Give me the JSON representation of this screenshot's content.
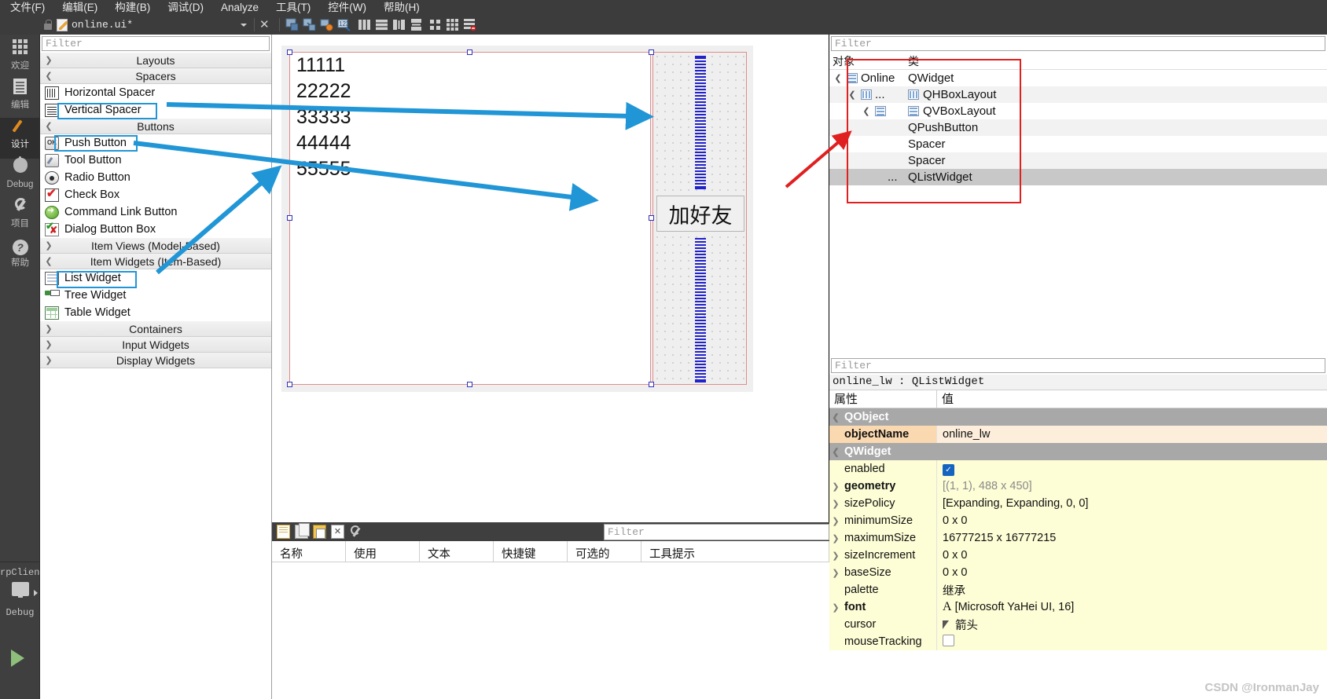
{
  "menubar": {
    "items": [
      "文件(F)",
      "编辑(E)",
      "构建(B)",
      "调试(D)",
      "Analyze",
      "工具(T)",
      "控件(W)",
      "帮助(H)"
    ]
  },
  "toolbar": {
    "filename": "online.ui*",
    "lock_icon": "lock-icon",
    "doc_icon": "ui-file-icon",
    "close_label": "✕",
    "icons": [
      "adjust-size-icon",
      "lay-out-break-icon",
      "signals-slots-icon",
      "buddy-edit-icon",
      "lay-out-horizontally-icon",
      "lay-out-vertically-icon",
      "lay-out-splitter-h-icon",
      "lay-out-splitter-v-icon",
      "lay-out-form-icon",
      "lay-out-grid-icon",
      "break-layout-icon"
    ]
  },
  "modebar": {
    "items": [
      {
        "label": "欢迎",
        "icon": "grid-icon",
        "active": false
      },
      {
        "label": "编辑",
        "icon": "document-icon",
        "active": false
      },
      {
        "label": "设计",
        "icon": "pencil-icon",
        "active": true
      },
      {
        "label": "Debug",
        "icon": "bug-icon",
        "active": false
      },
      {
        "label": "项目",
        "icon": "wrench-icon",
        "active": false
      },
      {
        "label": "帮助",
        "icon": "help-icon",
        "active": false
      }
    ],
    "kit_label": "rpClient",
    "kit_mode": "Debug",
    "run_icon": "run-play-icon",
    "target_icon": "monitor-icon"
  },
  "widgetbox": {
    "filter_placeholder": "Filter",
    "groups": [
      {
        "label": "Layouts",
        "expanded": false,
        "items": []
      },
      {
        "label": "Spacers",
        "expanded": true,
        "items": [
          {
            "label": "Horizontal Spacer",
            "icon": "horizontal-spacer-icon",
            "highlight": false
          },
          {
            "label": "Vertical Spacer",
            "icon": "vertical-spacer-icon",
            "highlight": true
          }
        ]
      },
      {
        "label": "Buttons",
        "expanded": true,
        "items": [
          {
            "label": "Push Button",
            "icon": "push-button-icon",
            "highlight": true
          },
          {
            "label": "Tool Button",
            "icon": "tool-button-icon",
            "highlight": false
          },
          {
            "label": "Radio Button",
            "icon": "radio-button-icon",
            "highlight": false
          },
          {
            "label": "Check Box",
            "icon": "check-box-icon",
            "highlight": false
          },
          {
            "label": "Command Link Button",
            "icon": "command-link-button-icon",
            "highlight": false
          },
          {
            "label": "Dialog Button Box",
            "icon": "dialog-button-box-icon",
            "highlight": false
          }
        ]
      },
      {
        "label": "Item Views (Model-Based)",
        "expanded": false,
        "items": []
      },
      {
        "label": "Item Widgets (Item-Based)",
        "expanded": true,
        "items": [
          {
            "label": "List Widget",
            "icon": "list-widget-icon",
            "highlight": true
          },
          {
            "label": "Tree Widget",
            "icon": "tree-widget-icon",
            "highlight": false
          },
          {
            "label": "Table Widget",
            "icon": "table-widget-icon",
            "highlight": false
          }
        ]
      },
      {
        "label": "Containers",
        "expanded": false,
        "items": []
      },
      {
        "label": "Input Widgets",
        "expanded": false,
        "items": []
      },
      {
        "label": "Display Widgets",
        "expanded": false,
        "items": []
      }
    ],
    "ok_glyph": "OK"
  },
  "canvas": {
    "list_items": [
      "11111",
      "22222",
      "33333",
      "44444",
      "55555"
    ],
    "button_label": "加好友",
    "spacer_top_name": "vertical-spacer-top",
    "spacer_bottom_name": "vertical-spacer-bottom"
  },
  "object_inspector": {
    "filter_placeholder": "Filter",
    "columns": [
      "对象",
      "类"
    ],
    "rows": [
      {
        "object": "Online",
        "class": "QWidget",
        "indent": 0,
        "expanded": true,
        "icon": "widget-icon",
        "selected": false
      },
      {
        "object": "...",
        "class": "QHBoxLayout",
        "indent": 1,
        "expanded": true,
        "icon": "hbox-layout-icon",
        "selected": false
      },
      {
        "object": "",
        "class": "QVBoxLayout",
        "indent": 2,
        "expanded": true,
        "icon": "vbox-layout-icon",
        "selected": false
      },
      {
        "object": "",
        "class": "QPushButton",
        "indent": 3,
        "expanded": null,
        "icon": "",
        "selected": false
      },
      {
        "object": "",
        "class": "Spacer",
        "indent": 3,
        "expanded": null,
        "icon": "",
        "selected": false
      },
      {
        "object": "",
        "class": "Spacer",
        "indent": 3,
        "expanded": null,
        "icon": "",
        "selected": false
      },
      {
        "object": "...",
        "class": "QListWidget",
        "indent": 2,
        "expanded": null,
        "icon": "",
        "selected": true
      }
    ]
  },
  "action_editor": {
    "filter_placeholder": "Filter",
    "toolbar_icons": [
      "new-action-icon",
      "copy-icon",
      "paste-icon",
      "delete-icon",
      "configure-icon"
    ],
    "columns": [
      "名称",
      "使用",
      "文本",
      "快捷键",
      "可选的",
      "工具提示"
    ],
    "rows": []
  },
  "property_editor": {
    "filter_placeholder": "Filter",
    "selection": "online_lw : QListWidget",
    "columns": [
      "属性",
      "值"
    ],
    "rows": [
      {
        "name": "QObject",
        "value": "",
        "kind": "group",
        "expandable": true
      },
      {
        "name": "objectName",
        "value": "online_lw",
        "kind": "orange",
        "expandable": false,
        "bold": true
      },
      {
        "name": "QWidget",
        "value": "",
        "kind": "group",
        "expandable": true
      },
      {
        "name": "enabled",
        "value": "",
        "kind": "yellow",
        "expandable": false,
        "widget": "checkbox-checked"
      },
      {
        "name": "geometry",
        "value": "[(1, 1), 488 x 450]",
        "kind": "yellow",
        "expandable": true,
        "bold": true,
        "grayvalue": true
      },
      {
        "name": "sizePolicy",
        "value": "[Expanding, Expanding, 0, 0]",
        "kind": "yellow",
        "expandable": true
      },
      {
        "name": "minimumSize",
        "value": "0 x 0",
        "kind": "yellow",
        "expandable": true
      },
      {
        "name": "maximumSize",
        "value": "16777215 x 16777215",
        "kind": "yellow",
        "expandable": true
      },
      {
        "name": "sizeIncrement",
        "value": "0 x 0",
        "kind": "yellow",
        "expandable": true
      },
      {
        "name": "baseSize",
        "value": "0 x 0",
        "kind": "yellow",
        "expandable": true
      },
      {
        "name": "palette",
        "value": "继承",
        "kind": "yellow",
        "expandable": false
      },
      {
        "name": "font",
        "value": "[Microsoft YaHei UI, 16]",
        "kind": "yellow",
        "expandable": true,
        "bold": true,
        "widget": "font-A"
      },
      {
        "name": "cursor",
        "value": "箭头",
        "kind": "yellow",
        "expandable": false,
        "widget": "cursor-arrow"
      },
      {
        "name": "mouseTracking",
        "value": "",
        "kind": "yellow",
        "expandable": false,
        "widget": "checkbox-empty"
      }
    ]
  },
  "watermark": "CSDN @IronmanJay",
  "colors": {
    "annotation_blue": "#2196d6",
    "annotation_red": "#e02020",
    "dark_chrome": "#3c3c3c",
    "accent_selection": "#c8c8c8"
  }
}
